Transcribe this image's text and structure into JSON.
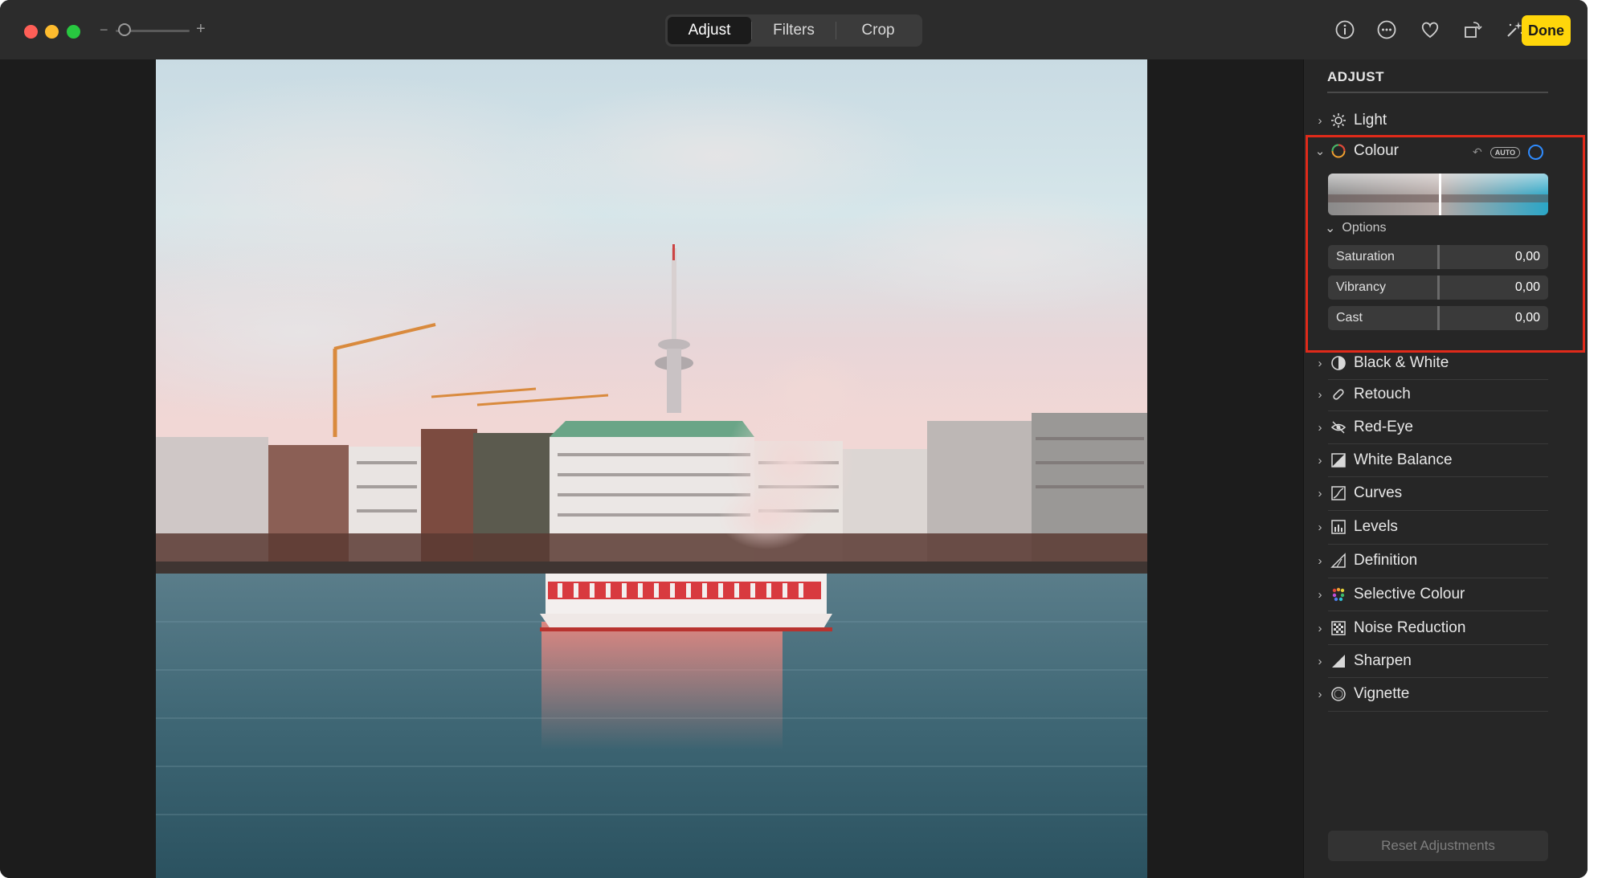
{
  "toolbar": {
    "tabs": [
      {
        "label": "Adjust",
        "active": true
      },
      {
        "label": "Filters",
        "active": false
      },
      {
        "label": "Crop",
        "active": false
      }
    ],
    "zoom_minus": "−",
    "zoom_plus": "+",
    "done_label": "Done",
    "icons": [
      "info-icon",
      "more-icon",
      "favorite-icon",
      "rotate-icon",
      "auto-enhance-icon"
    ]
  },
  "sidebar": {
    "title": "ADJUST",
    "colour": {
      "label": "Colour",
      "auto_label": "AUTO",
      "options_label": "Options",
      "sliders": [
        {
          "name": "Saturation",
          "value": "0,00"
        },
        {
          "name": "Vibrancy",
          "value": "0,00"
        },
        {
          "name": "Cast",
          "value": "0,00"
        }
      ]
    },
    "items": [
      {
        "label": "Light",
        "icon": "sun-icon"
      },
      {
        "label": "Black & White",
        "icon": "half-circle-icon"
      },
      {
        "label": "Retouch",
        "icon": "bandage-icon"
      },
      {
        "label": "Red-Eye",
        "icon": "eye-icon"
      },
      {
        "label": "White Balance",
        "icon": "white-balance-icon"
      },
      {
        "label": "Curves",
        "icon": "curves-icon"
      },
      {
        "label": "Levels",
        "icon": "levels-icon"
      },
      {
        "label": "Definition",
        "icon": "definition-icon"
      },
      {
        "label": "Selective Colour",
        "icon": "selective-colour-icon"
      },
      {
        "label": "Noise Reduction",
        "icon": "noise-icon"
      },
      {
        "label": "Sharpen",
        "icon": "sharpen-icon"
      },
      {
        "label": "Vignette",
        "icon": "vignette-icon"
      }
    ],
    "reset_label": "Reset Adjustments"
  },
  "colors": {
    "accent_done": "#ffd60a",
    "highlight_box": "#e02a1a",
    "blue_indicator": "#2f8cff"
  }
}
